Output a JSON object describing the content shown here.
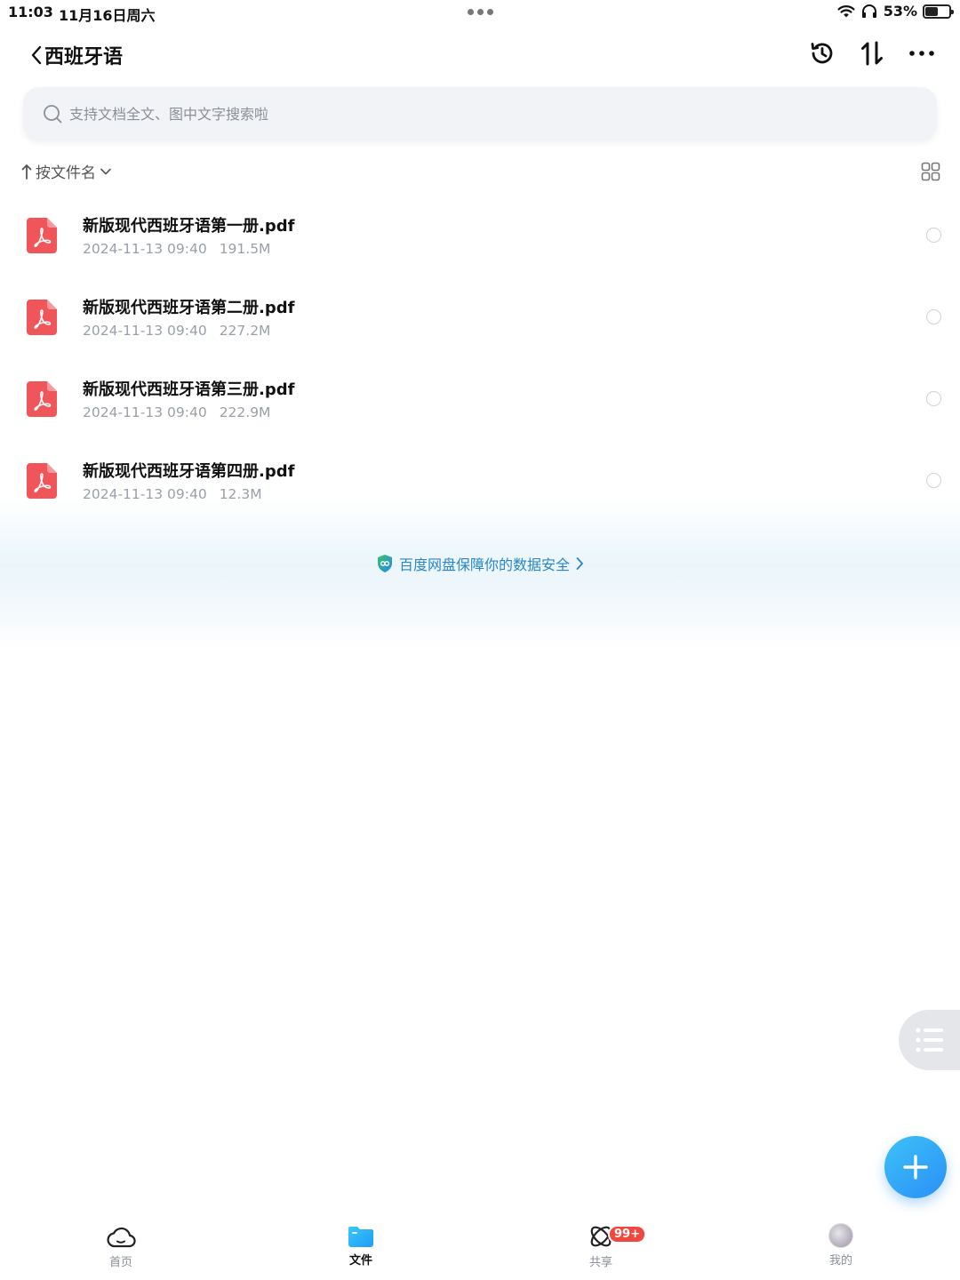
{
  "status_bar": {
    "time": "11:03",
    "date": "11月16日周六",
    "battery_percent": "53%",
    "battery_level": 0.53
  },
  "header": {
    "title": "西班牙语",
    "icons": [
      "back-chevron-icon",
      "history-icon",
      "transfer-icon",
      "more-icon"
    ]
  },
  "search": {
    "placeholder": "支持文档全文、图中文字搜索啦"
  },
  "sort": {
    "label": "按文件名"
  },
  "files": [
    {
      "name": "新版现代西班牙语第一册.pdf",
      "date": "2024-11-13 09:40",
      "size": "191.5M"
    },
    {
      "name": "新版现代西班牙语第二册.pdf",
      "date": "2024-11-13 09:40",
      "size": "227.2M"
    },
    {
      "name": "新版现代西班牙语第三册.pdf",
      "date": "2024-11-13 09:40",
      "size": "222.9M"
    },
    {
      "name": "新版现代西班牙语第四册.pdf",
      "date": "2024-11-13 09:40",
      "size": "12.3M"
    }
  ],
  "security_banner": {
    "text": "百度网盘保障你的数据安全"
  },
  "tabbar": {
    "tabs": [
      {
        "label": "首页"
      },
      {
        "label": "文件"
      },
      {
        "label": "共享"
      },
      {
        "label": "我的"
      }
    ],
    "share_badge": "99+"
  },
  "colors": {
    "accent": "#2a8ff7",
    "pdf_red": "#f0555a",
    "badge_red": "#f0483e",
    "link_blue": "#2a86c7"
  }
}
